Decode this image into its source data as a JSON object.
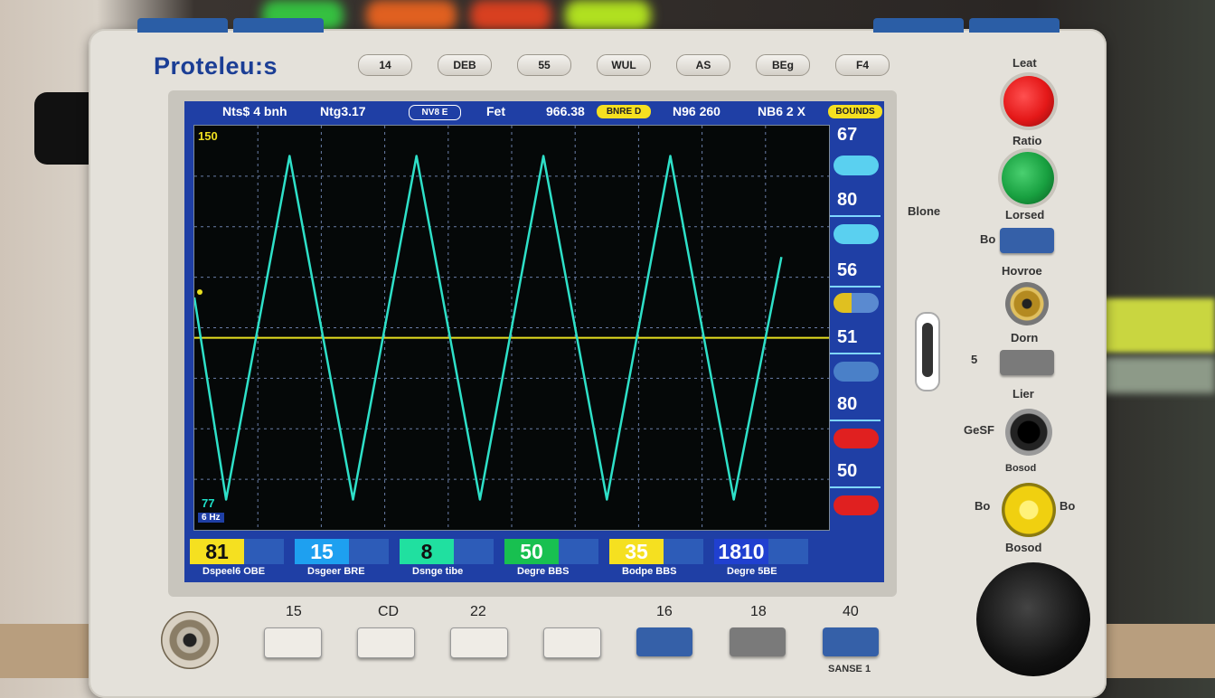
{
  "device": {
    "brand": "Proteleu:s",
    "top_buttons": [
      "14",
      "DEB",
      "55",
      "WUL",
      "AS",
      "BEg",
      "F4"
    ]
  },
  "screen": {
    "status": [
      "Nts$ 4 bnh",
      "Ntg3.17",
      "NV8 E",
      "Fet",
      "966.38",
      "BNRE D",
      "N96 260",
      "NB6 2 X",
      "BOUNDS"
    ],
    "plot": {
      "top_left_label": "150",
      "bottom_left_label": "77",
      "bottom_left_sublabel": "6 Hz",
      "trace_color": "#2ee0c8",
      "baseline_color": "#e8e020"
    },
    "side_values": [
      "67",
      "80",
      "56",
      "51",
      "80",
      "50"
    ],
    "side_button_colors": [
      "#5ad0f0",
      "#5ad0f0",
      "#e0c020",
      "#4a80c8",
      "#e02020",
      "#e02020"
    ],
    "measurements": [
      {
        "value": "81",
        "label": "Dspeel6 OBE",
        "color": "#f5e020",
        "text": "#111"
      },
      {
        "value": "15",
        "label": "Dsgeer BRE",
        "color": "#1ea0f0",
        "text": "#fff"
      },
      {
        "value": "8",
        "label": "Dsnge tibe",
        "color": "#20e0a0",
        "text": "#111"
      },
      {
        "value": "50",
        "label": "Degre BBS",
        "color": "#18c050",
        "text": "#fff"
      },
      {
        "value": "35",
        "label": "Bodpe BBS",
        "color": "#f5e020",
        "text": "#fff"
      },
      {
        "value": "1810",
        "label": "Degre 5BE",
        "color": "#2040d0",
        "text": "#fff"
      }
    ]
  },
  "right_panel": {
    "labels": [
      "Leat",
      "Ratio",
      "Lorsed",
      "Hovroe",
      "Dorn",
      "Lier",
      "Bosod",
      "Blone",
      "Bo",
      "5",
      "GeSF",
      "Bo",
      "Bo"
    ],
    "button_colors": {
      "red": "#e41818",
      "green": "#18a040",
      "yellow": "#f0d010"
    }
  },
  "bottom": {
    "labels": [
      "15",
      "CD",
      "22",
      "16",
      "18",
      "40"
    ],
    "sense_label": "SANSE 1"
  },
  "chart_data": {
    "type": "line",
    "series": [
      {
        "values": [
          0.15,
          -0.85,
          0.85,
          -0.85,
          0.85,
          -0.85,
          0.85,
          -0.85,
          0.85,
          -0.85,
          0.35
        ]
      }
    ],
    "x": [
      0,
      0.5,
      1.5,
      2.5,
      3.5,
      4.5,
      5.5,
      6.5,
      7.5,
      8.5,
      9.25
    ],
    "ylim": [
      -1,
      1
    ],
    "baseline": -0.05,
    "grid": true,
    "grid_divisions_x": 10,
    "grid_divisions_y": 8
  }
}
